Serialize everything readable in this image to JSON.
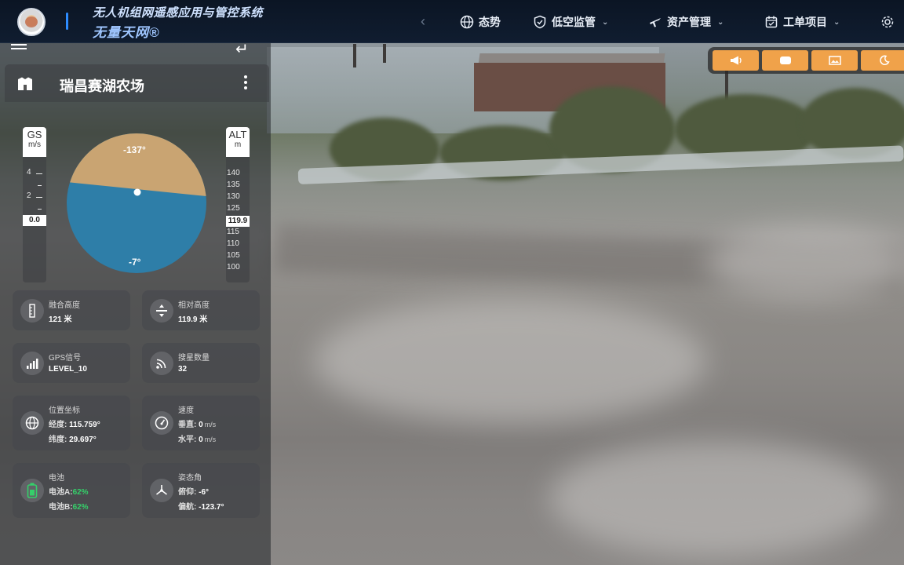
{
  "header": {
    "title": "无人机组网遥感应用与管控系统",
    "subtitle": "无量天网®",
    "nav_prev": "‹",
    "nav": [
      {
        "label": "态势",
        "icon": "globe-icon",
        "has_dropdown": false
      },
      {
        "label": "低空监管",
        "icon": "shield-icon",
        "has_dropdown": true
      },
      {
        "label": "资产管理",
        "icon": "plane-icon",
        "has_dropdown": true
      },
      {
        "label": "工单项目",
        "icon": "calendar-icon",
        "has_dropdown": true
      }
    ]
  },
  "toolbar": {
    "buttons": [
      "megaphone-icon",
      "screen-icon",
      "image-icon",
      "moon-icon"
    ]
  },
  "panel": {
    "title": "瑞昌赛湖农场",
    "gs": {
      "label": "GS",
      "unit": "m/s",
      "ticks": [
        "4",
        "2"
      ],
      "value": "0.0"
    },
    "alt": {
      "label": "ALT",
      "unit": "m",
      "ticks": [
        "140",
        "135",
        "130",
        "125",
        "115",
        "110",
        "105",
        "100"
      ],
      "value": "119.9"
    },
    "attitude": {
      "top_label": "-137°",
      "bottom_label": "-7°",
      "colors": {
        "sky": "#c9a472",
        "ground": "#2e7ea8"
      }
    },
    "cards": {
      "fused_alt": {
        "label": "融合高度",
        "value": "121 米"
      },
      "rel_alt": {
        "label": "相对高度",
        "value": "119.9 米"
      },
      "gps": {
        "label": "GPS信号",
        "value": "LEVEL_10"
      },
      "sats": {
        "label": "搜星数量",
        "value": "32"
      },
      "position": {
        "label": "位置坐标",
        "lon_k": "经度:",
        "lon_v": "115.759°",
        "lat_k": "纬度:",
        "lat_v": "29.697°"
      },
      "speed": {
        "label": "速度",
        "v_k": "垂直:",
        "v_v": "0",
        "h_k": "水平:",
        "h_v": "0",
        "unit": "m/s"
      },
      "battery": {
        "label": "电池",
        "a_k": "电池A:",
        "a_v": "62%",
        "b_k": "电池B:",
        "b_v": "62%"
      },
      "attitude_angle": {
        "label": "姿态角",
        "pitch_k": "俯仰:",
        "pitch_v": "-6°",
        "yaw_k": "偏航:",
        "yaw_v": "-123.7°"
      }
    }
  },
  "colors": {
    "accent": "#f0a24a",
    "battery_ok": "#35d06a",
    "topbar": "#0b1524"
  }
}
